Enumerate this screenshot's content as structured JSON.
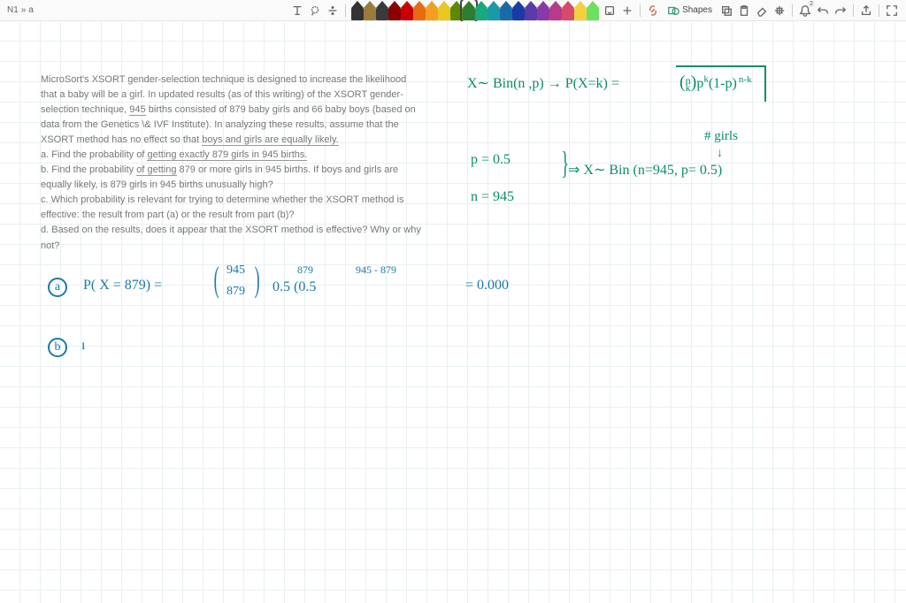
{
  "breadcrumb": {
    "level1": "N1",
    "sep": "»",
    "level2": "a"
  },
  "toolbar": {
    "shapes_label": "Shapes",
    "notif_count": "2",
    "pen_colors": [
      "#333333",
      "#9a7b3a",
      "#3a3a3a",
      "#8c0000",
      "#c80000",
      "#e96b0f",
      "#f0a020",
      "#e8c820",
      "#5b8a00",
      "#2e7d32",
      "#1aa87d",
      "#1a9aa8",
      "#1a6aa8",
      "#1a3aa8",
      "#5a3aa8",
      "#8a3aa8",
      "#b83a88",
      "#d84a6a",
      "#f3d040",
      "#6de060"
    ],
    "selected_pen": 9
  },
  "problem": {
    "p1a": "MicroSort's XSORT gender-selection technique is designed to increase the likelihood that a baby will be a girl. In updated results (as of this writing) of the XSORT gender-selection technique, ",
    "p1b": "945",
    "p1c": " births consisted of 879 baby girls and 66 baby boys (based on data from the Genetics \\& IVF Institute). In analyzing these results, assume that the XSORT method has no effect so that ",
    "p1d": "boys and girls are equally likely.",
    "pa1": "a. Find the probability of ",
    "pa2": "getting exactly 879 girls in 945 births.",
    "pb1": "b. Find the probability ",
    "pb2": "of getting",
    "pb3": " 879 or more girls in 945 births. If boys and girls are equally likely, is 879 girls in 945 births unusually high?",
    "pc": "c. Which probability is relevant for trying to determine whether the XSORT method is effective: the result from part (a) or the result from part (b)?",
    "pd": "d. Based on the results, does it appear that the XSORT method is effective? Why or why not?"
  },
  "hand": {
    "dist": "X∼ Bin(n ,p) → P(X=k) =",
    "formula": "( ⁿₖ )pᵏ(1-p)ⁿ⁻ᵏ",
    "girls_label": "# girls",
    "p_eq": "p = 0.5",
    "n_eq": "n = 945",
    "imply": "⇒ X∼ Bin (n=945, p= 0.5)",
    "arrow": "↓",
    "a_label": "a",
    "a_eq1": "P( X = 879) =",
    "a_binom_top": "945",
    "a_binom_bot": "879",
    "a_exp1": "879",
    "a_mid": "0.5     (0.5",
    "a_exp2": "945 - 879",
    "a_result": "= 0.000",
    "b_label": "b",
    "b_start": "ı"
  }
}
